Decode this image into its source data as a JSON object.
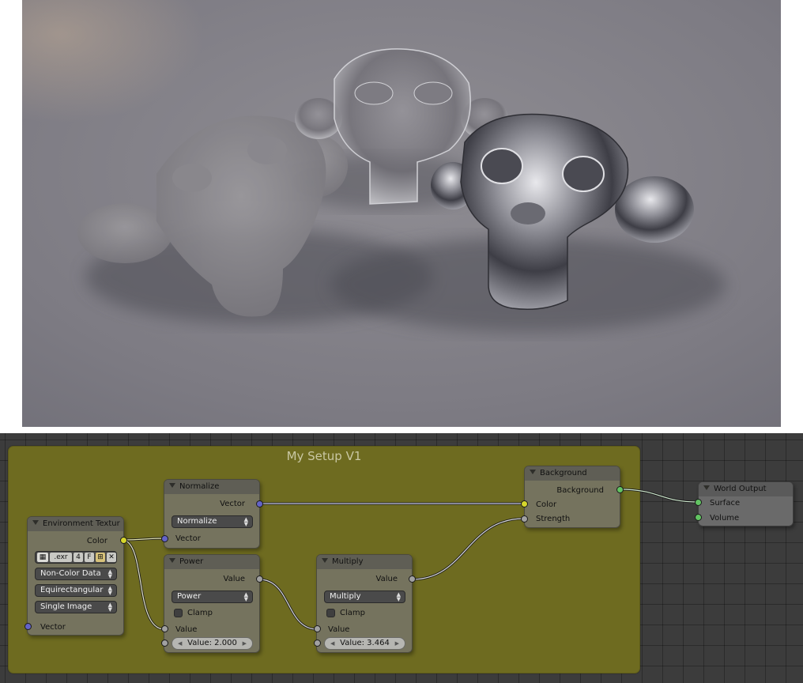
{
  "render_preview": {
    "description_icon": "render-preview"
  },
  "editor": {
    "frame_title": "My Setup V1",
    "nodes": {
      "environment": {
        "title": "Environment Textur",
        "output_color": "Color",
        "image_name": ".exr",
        "users": "4",
        "fake_user": "F",
        "color_space": "Non-Color Data",
        "projection": "Equirectangular",
        "source": "Single Image",
        "input_vector": "Vector"
      },
      "normalize": {
        "title": "Normalize",
        "output_vector": "Vector",
        "operation": "Normalize",
        "input_vector": "Vector"
      },
      "power": {
        "title": "Power",
        "output_value": "Value",
        "operation": "Power",
        "clamp_label": "Clamp",
        "input_value": "Value",
        "value_field": "Value: 2.000"
      },
      "multiply": {
        "title": "Multiply",
        "output_value": "Value",
        "operation": "Multiply",
        "clamp_label": "Clamp",
        "input_value": "Value",
        "value_field": "Value: 3.464"
      },
      "background": {
        "title": "Background",
        "output_background": "Background",
        "input_color": "Color",
        "input_strength": "Strength"
      },
      "world_output": {
        "title": "World Output",
        "input_surface": "Surface",
        "input_volume": "Volume"
      }
    },
    "colors": {
      "frame": "#6e6b20",
      "node_body": "#75735e",
      "socket_color": "#d6d62c",
      "socket_vector": "#6363c7",
      "socket_value": "#a1a1a1",
      "socket_shader": "#62c462"
    }
  }
}
